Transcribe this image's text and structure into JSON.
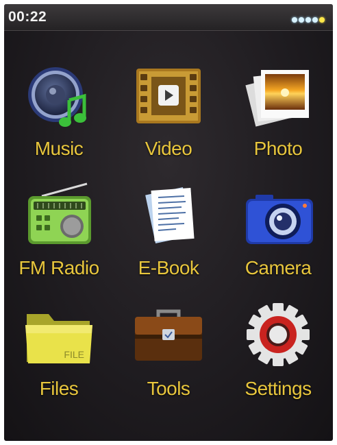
{
  "status_bar": {
    "time": "00:22",
    "battery_icon": "battery-level-icon"
  },
  "menu": {
    "label_color": "#e8c63d",
    "items": [
      {
        "label": "Music",
        "icon": "music-icon"
      },
      {
        "label": "Video",
        "icon": "video-icon"
      },
      {
        "label": "Photo",
        "icon": "photo-icon"
      },
      {
        "label": "FM Radio",
        "icon": "radio-icon"
      },
      {
        "label": "E-Book",
        "icon": "ebook-icon"
      },
      {
        "label": "Camera",
        "icon": "camera-icon"
      },
      {
        "label": "Files",
        "icon": "folder-icon",
        "icon_text": "FILE"
      },
      {
        "label": "Tools",
        "icon": "toolbox-icon"
      },
      {
        "label": "Settings",
        "icon": "gear-icon"
      }
    ]
  }
}
